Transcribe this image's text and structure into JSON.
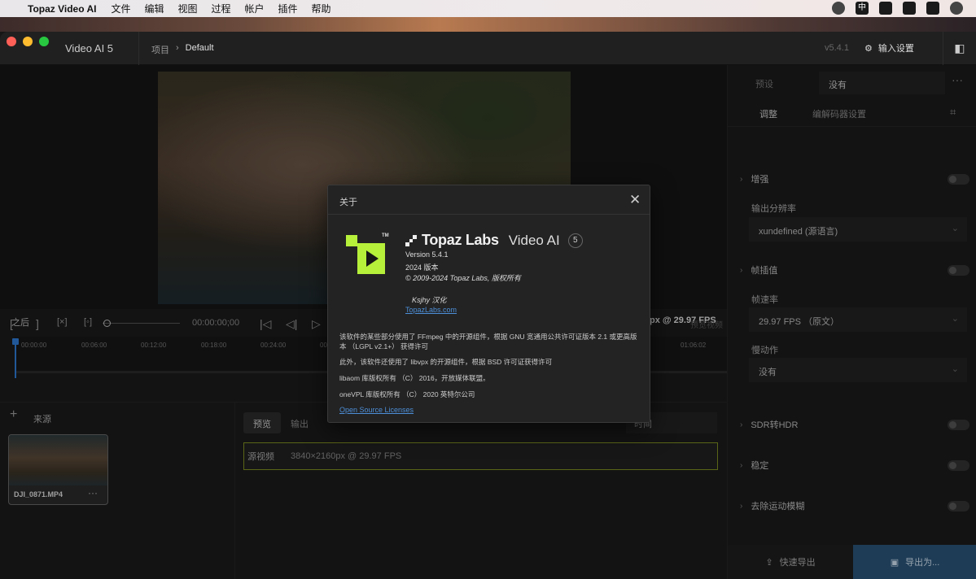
{
  "menubar": {
    "app_name": "Topaz Video AI",
    "items": [
      "文件",
      "编辑",
      "视图",
      "过程",
      "帐户",
      "插件",
      "帮助"
    ],
    "status_icons": [
      "siri-icon",
      "input-method-icon",
      "app-icon",
      "notification-icon",
      "screen-icon",
      "settings-icon"
    ],
    "input_method": "中"
  },
  "titlebar": {
    "brand": "Video AI  5",
    "breadcrumb_parent": "项目",
    "breadcrumb_current": "Default",
    "version": "v5.4.1",
    "input_settings": "输入设置"
  },
  "preview": {
    "after_label": "之后",
    "fps_label": "px @ 29.97 FPS",
    "timecode": "00:00:00;00",
    "ticks": [
      "00:00:00",
      "00:06:00",
      "00:12:00",
      "00:18:00",
      "00:24:00",
      "00:30",
      "01:06:02"
    ],
    "compare_label": "预览视频"
  },
  "sources": {
    "title": "来源",
    "file_name": "DJI_0871.MP4",
    "more": "···"
  },
  "output": {
    "tab_preview": "预览",
    "tab_output": "输出",
    "sort_label": "时间",
    "source_row_label": "源视频",
    "source_row_value": "3840×2160px @ 29.97 FPS"
  },
  "right_panel": {
    "preset_label": "预设",
    "preset_value": "没有",
    "tab_adjust": "调整",
    "tab_codec": "编解码器设置",
    "enhance": "增强",
    "output_res_label": "输出分辨率",
    "output_res_value": "xundefined (源语言)",
    "frame_interp": "帧插值",
    "frame_rate_label": "帧速率",
    "frame_rate_value": "29.97 FPS （原文）",
    "slowmo_label": "慢动作",
    "slowmo_value": "没有",
    "sdr_hdr": "SDR转HDR",
    "stabilize": "稳定",
    "motion_deblur": "去除运动模糊",
    "quick_export": "快速导出",
    "export_as": "导出为..."
  },
  "about": {
    "title": "关于",
    "brand_main": "Topaz Labs",
    "brand_product": "Video AI",
    "brand_version_badge": "5",
    "tm": "TM",
    "version_line": "Version 5.4.1",
    "year_line": "2024 版本",
    "copyright": "© 2009-2024 Topaz Labs,  版权所有",
    "translator": "Ksjhy 汉化",
    "website": "TopazLabs.com",
    "para1": "该软件的某些部分使用了 FFmpeg 中的开源组件，根据 GNU 宽通用公共许可证版本 2.1 或更高版本 （LGPL v2.1+） 获得许可",
    "para2": "此外，该软件还使用了 libvpx 的开源组件，根据 BSD 许可证获得许可",
    "para3": "libaom 库版权所有 （C） 2016，开放媒体联盟。",
    "para4": "oneVPL 库版权所有 （C） 2020 英特尔公司",
    "licenses_link": "Open Source Licenses"
  }
}
